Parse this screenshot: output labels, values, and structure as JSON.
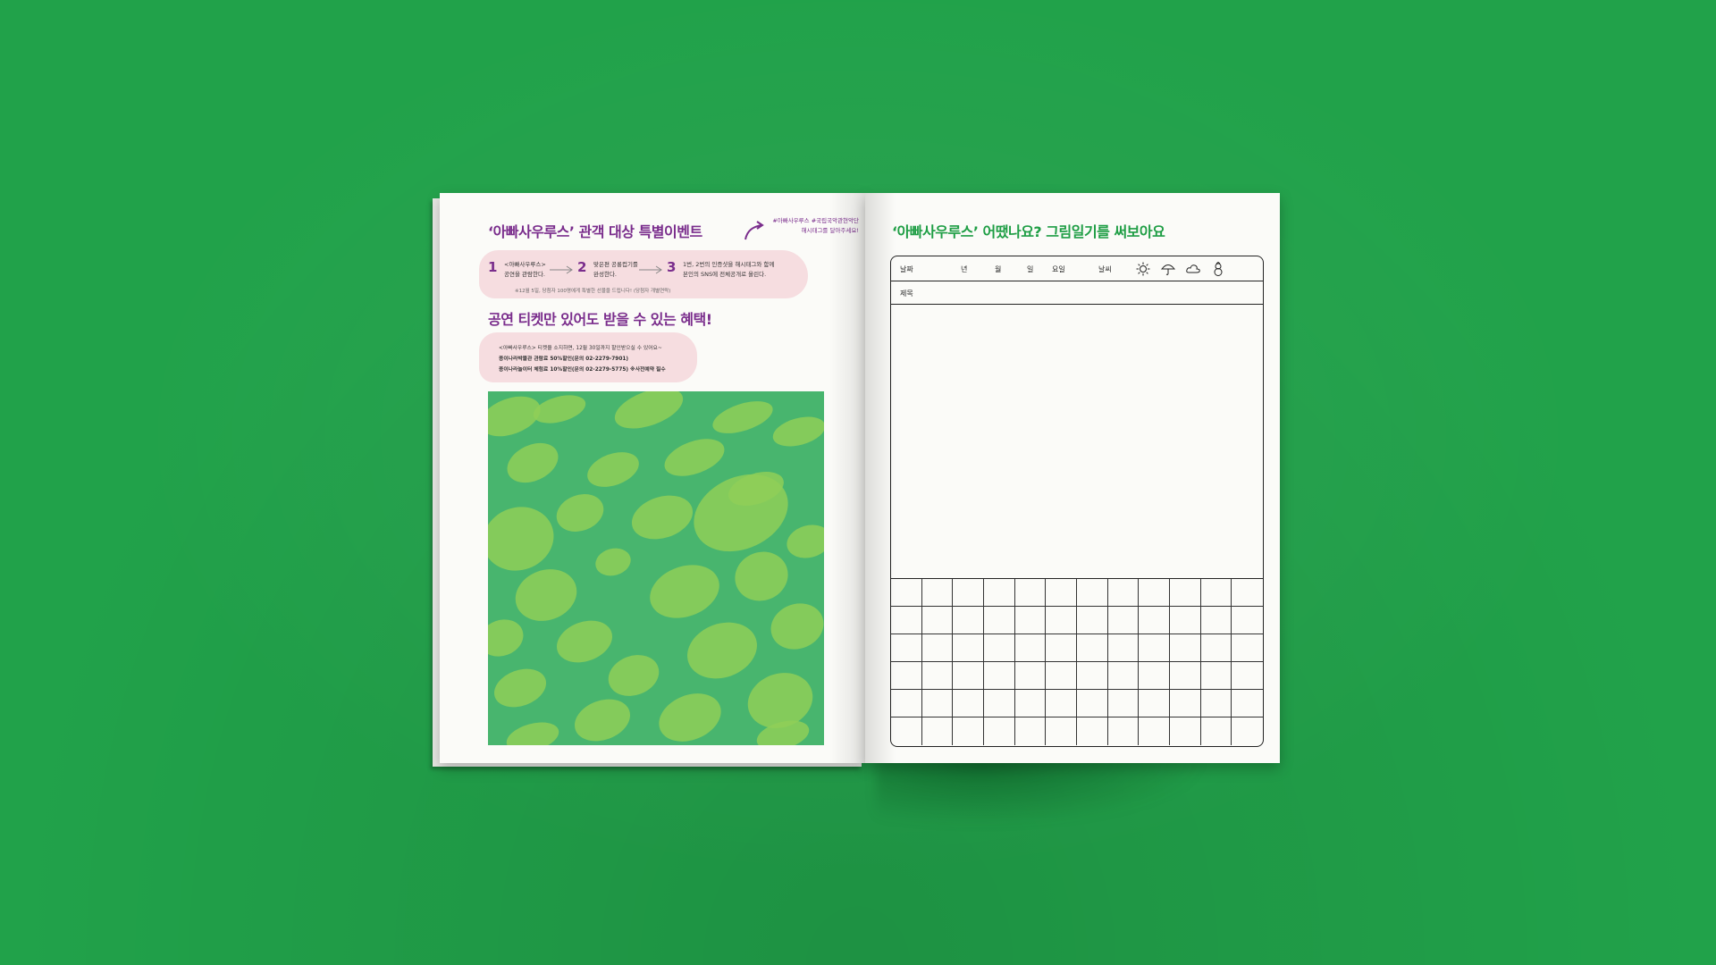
{
  "left_page": {
    "title": "‘아빠사우루스’ 관객 대상 특별이벤트",
    "hashtag_line1": "#아빠사우루스 #국립국악관현악단",
    "hashtag_line2": "해시태그를 달아주세요!",
    "steps": [
      {
        "num": "1",
        "line1": "<아빠사우루스>",
        "line2": "공연을 관람한다."
      },
      {
        "num": "2",
        "line1": "맞은편 공룡컵기를",
        "line2": "완성한다."
      },
      {
        "num": "3",
        "line1": "1번, 2번의 인증샷을 해시태그와 함께",
        "line2": "본인의 SNS에 전체공개로 올린다."
      }
    ],
    "step_note": "※12월 5일, 당첨자 100명에게 특별한 선물을 드립니다! (당첨자 개별연락)",
    "benefit_title": "공연 티켓만 있어도 받을 수 있는 혜택!",
    "benefit_lines": [
      "<아빠사우루스> 티켓을 소지하면, 12월 30일까지 할인받으실 수 있어요~",
      "종이나라박물관 관람료 50%할인(문의 02-2279-7901)",
      "종이나라놀이터 체험료 10%할인(문의 02-2279-5775) ※사전예약 필수"
    ]
  },
  "right_page": {
    "title": "‘아빠사우루스’ 어땠나요? 그림일기를 써보아요",
    "labels": {
      "date": "날짜",
      "year": "년",
      "month": "월",
      "day": "일",
      "weekday": "요일",
      "weather": "날씨",
      "title": "제목"
    },
    "weather_icons": [
      "sun-icon",
      "umbrella-icon",
      "cloud-icon",
      "snowman-icon"
    ],
    "grid": {
      "columns": 12,
      "rows": 6
    }
  },
  "colors": {
    "background": "#21a24a",
    "purple_accent": "#7a2d8c",
    "green_accent": "#1f9e45",
    "pink_highlight": "#f6dde0",
    "pattern_green": "#48b56e",
    "pattern_lime": "#8fcf58"
  }
}
